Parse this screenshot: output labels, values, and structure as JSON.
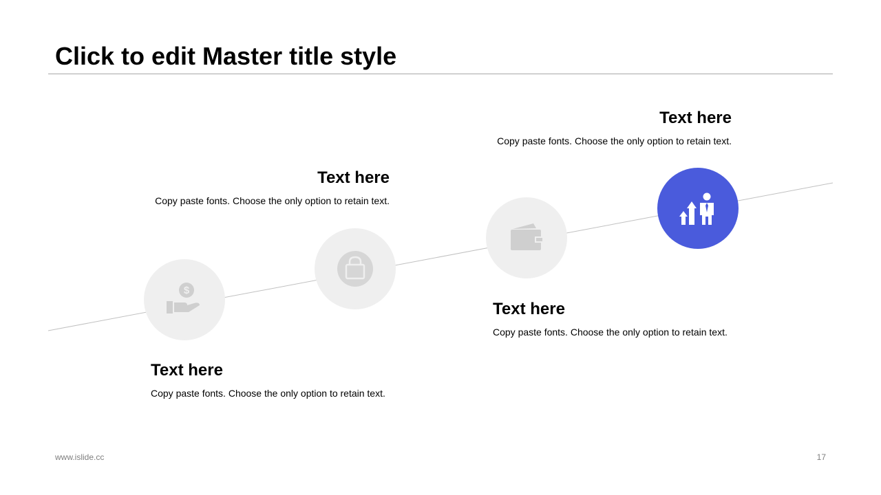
{
  "title": "Click to edit Master title style",
  "steps": [
    {
      "heading": "Text here",
      "body": "Copy paste fonts. Choose the only option to retain text.",
      "icon": "money-hand-icon",
      "active": false
    },
    {
      "heading": "Text here",
      "body": "Copy paste fonts. Choose the only option to retain text.",
      "icon": "shopping-bag-icon",
      "active": false
    },
    {
      "heading": "Text here",
      "body": "Copy paste fonts. Choose the only option to retain text.",
      "icon": "wallet-icon",
      "active": false
    },
    {
      "heading": "Text here",
      "body": "Copy paste fonts. Choose the only option to retain text.",
      "icon": "growth-businessman-icon",
      "active": true
    }
  ],
  "colors": {
    "accent": "#4a5bdc",
    "inactive_circle": "#efefef",
    "inactive_icon": "#c9c9c9",
    "line": "#c0c0c0"
  },
  "footer": {
    "website": "www.islide.cc",
    "page_number": "17"
  }
}
